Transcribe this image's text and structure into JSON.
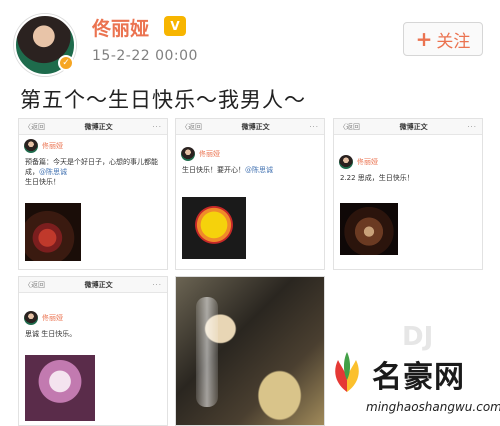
{
  "header": {
    "username": "佟丽娅",
    "timestamp": "15-2-22 00:00",
    "follow_label": "关注",
    "follow_plus": "+",
    "vip_badge": "V"
  },
  "post": {
    "text": "第五个～生日快乐～我男人～"
  },
  "thumbs": [
    {
      "nav_back": "〈返回",
      "nav_title": "微博正文",
      "nav_more": "···",
      "name": "佟丽娅",
      "text": "预备篇：今天是个好日子，心想的事儿都能成，",
      "text2": "生日快乐！",
      "at": "@陈思诚"
    },
    {
      "nav_back": "〈返回",
      "nav_title": "微博正文",
      "nav_more": "···",
      "name": "佟丽娅",
      "text": "生日快乐！要开心！",
      "at": "@陈思诚"
    },
    {
      "nav_back": "〈返回",
      "nav_title": "微博正文",
      "nav_more": "···",
      "name": "佟丽娅",
      "text": "2.22 思成，生日快乐！"
    },
    {
      "nav_back": "〈返回",
      "nav_title": "微博正文",
      "nav_more": "···",
      "name": "佟丽娅",
      "text": "思诚 生日快乐。"
    }
  ],
  "watermark": {
    "brand": "名豪网",
    "url": "minghaoshangwu.com"
  }
}
